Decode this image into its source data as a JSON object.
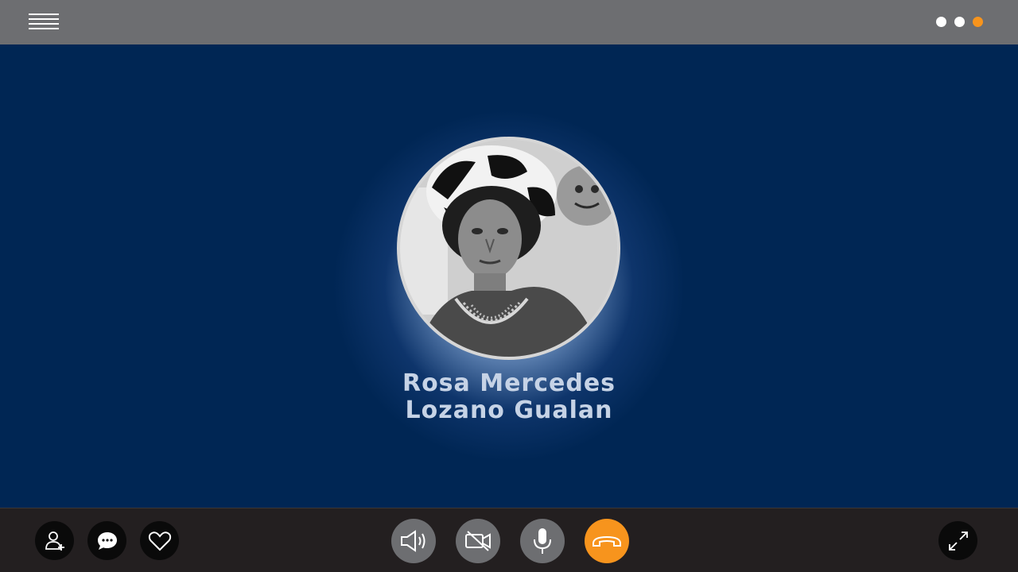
{
  "topbar": {
    "menu_icon": "hamburger-menu-icon",
    "page_indicator": {
      "count": 3,
      "active_index": 2,
      "active_color": "#f7941d",
      "inactive_color": "#ffffff"
    }
  },
  "call": {
    "caller_name_line1": "Rosa Mercedes",
    "caller_name_line2": "Lozano Gualan",
    "avatar": "caller-avatar-photo"
  },
  "controls": {
    "left": [
      {
        "icon": "add-contact-icon"
      },
      {
        "icon": "chat-bubble-icon"
      },
      {
        "icon": "heart-icon"
      }
    ],
    "center": [
      {
        "icon": "speaker-icon"
      },
      {
        "icon": "video-off-icon"
      },
      {
        "icon": "microphone-icon"
      },
      {
        "icon": "hang-up-phone-icon",
        "color": "#f7941d"
      }
    ],
    "right": [
      {
        "icon": "fullscreen-expand-icon"
      }
    ]
  },
  "colors": {
    "background": "#002654",
    "topbar": "#6d6e71",
    "bottombar": "#231f20",
    "accent": "#f7941d"
  }
}
